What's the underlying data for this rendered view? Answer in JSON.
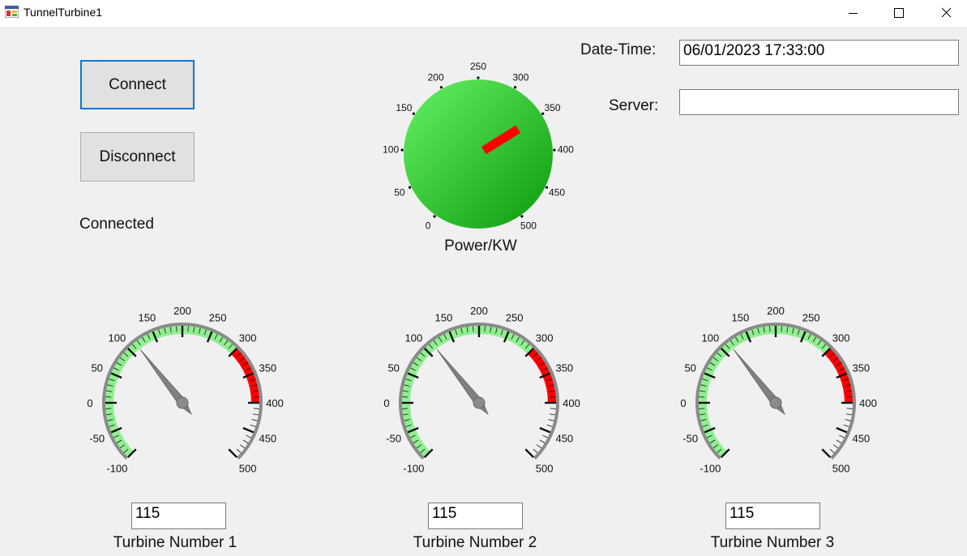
{
  "window": {
    "title": "TunnelTurbine1",
    "icon": "app-window-icon",
    "controls": [
      "minimize-icon",
      "maximize-icon",
      "close-icon"
    ]
  },
  "connection": {
    "connect_label": "Connect",
    "disconnect_label": "Disconnect",
    "status": "Connected"
  },
  "info": {
    "datetime_label": "Date-Time:",
    "datetime_value": "06/01/2023 17:33:00",
    "server_label": "Server:",
    "server_value": ""
  },
  "power_gauge": {
    "caption": "Power/KW",
    "ticks": [
      "0",
      "50",
      "100",
      "150",
      "200",
      "250",
      "300",
      "350",
      "400",
      "450",
      "500"
    ],
    "value": 350,
    "face_color": "#3ccc3c",
    "needle_color": "#ff0000"
  },
  "turbines": [
    {
      "caption": "Turbine Number 1",
      "value": "115",
      "ticks": [
        "-100",
        "-50",
        "0",
        "50",
        "100",
        "150",
        "200",
        "250",
        "300",
        "350",
        "400",
        "450",
        "500"
      ]
    },
    {
      "caption": "Turbine Number 2",
      "value": "115",
      "ticks": [
        "-100",
        "-50",
        "0",
        "50",
        "100",
        "150",
        "200",
        "250",
        "300",
        "350",
        "400",
        "450",
        "500"
      ]
    },
    {
      "caption": "Turbine Number 3",
      "value": "115",
      "ticks": [
        "-100",
        "-50",
        "0",
        "50",
        "100",
        "150",
        "200",
        "250",
        "300",
        "350",
        "400",
        "450",
        "500"
      ]
    }
  ],
  "colors": {
    "green_band": "#90ee90",
    "red_band": "#ff0000",
    "needle": "#808080",
    "focus_border": "#0078d7"
  }
}
